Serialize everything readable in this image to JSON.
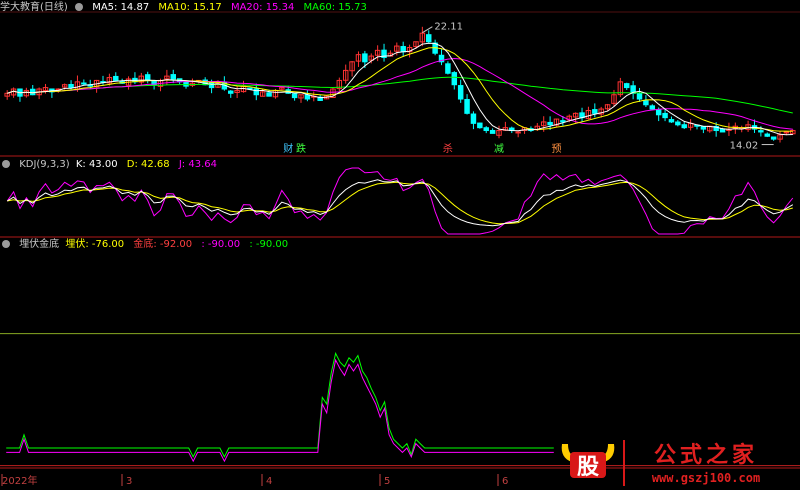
{
  "main_panel": {
    "title": "学大教育(日线)",
    "ma_labels": [
      {
        "label": "MA5: 14.87",
        "color": "#ffffff"
      },
      {
        "label": "MA10: 15.17",
        "color": "#ffff00"
      },
      {
        "label": "MA20: 15.34",
        "color": "#ff00ff"
      },
      {
        "label": "MA60: 15.73",
        "color": "#00ff00"
      }
    ],
    "high_annotation": "22.11",
    "low_annotation": "14.02",
    "signal_labels": [
      {
        "text": "财",
        "color": "#40c8ff"
      },
      {
        "text": "跌",
        "color": "#40ff40"
      },
      {
        "text": "杀",
        "color": "#ff4040"
      },
      {
        "text": "减",
        "color": "#40ff40"
      },
      {
        "text": "预",
        "color": "#ff9040"
      }
    ]
  },
  "kdj_panel": {
    "title": "KDJ(9,3,3)",
    "values": [
      {
        "label": "K: 43.00",
        "color": "#ffffff"
      },
      {
        "label": "D: 42.68",
        "color": "#ffff00"
      },
      {
        "label": "J: 43.64",
        "color": "#ff00ff"
      }
    ]
  },
  "indicator_panel": {
    "title": "埋伏金底",
    "values": [
      {
        "label": "埋伏: -76.00",
        "color": "#ffff00"
      },
      {
        "label": "金底: -92.00",
        "color": "#ff4040"
      },
      {
        "label": ": -90.00",
        "color": "#ff00ff"
      },
      {
        "label": ": -90.00",
        "color": "#00ff00"
      }
    ]
  },
  "x_axis_labels": [
    "2022年",
    "3",
    "4",
    "5",
    "6"
  ],
  "watermark": {
    "logo_char": "股",
    "text": "公式之家",
    "url": "www.gszj100.com"
  },
  "chart_data": [
    {
      "type": "candlestick",
      "title": "学大教育(日线)",
      "y_annotated": {
        "high": 22.11,
        "low": 14.02
      },
      "ma_last": {
        "MA5": 14.87,
        "MA10": 15.17,
        "MA20": 15.34,
        "MA60": 15.73
      },
      "ylim": [
        13.5,
        23.0
      ],
      "colors": {
        "up": "#ff3232",
        "down": "#00ffff",
        "ma5": "#ffffff",
        "ma10": "#ffff00",
        "ma20": "#ff00ff",
        "ma60": "#00ff00"
      },
      "closes": [
        17.6,
        17.9,
        17.4,
        17.8,
        17.5,
        17.9,
        18.0,
        17.7,
        17.9,
        18.2,
        18.0,
        18.4,
        18.3,
        18.1,
        18.5,
        18.4,
        18.7,
        18.5,
        18.3,
        18.6,
        18.4,
        18.8,
        18.5,
        18.2,
        18.5,
        18.8,
        18.6,
        18.4,
        18.1,
        18.3,
        18.5,
        18.2,
        18.0,
        18.3,
        17.9,
        17.6,
        17.8,
        18.1,
        17.9,
        17.5,
        17.7,
        17.4,
        17.8,
        18.0,
        17.6,
        17.3,
        17.5,
        17.2,
        17.4,
        17.1,
        17.4,
        17.9,
        18.5,
        19.2,
        19.8,
        20.3,
        19.8,
        20.2,
        20.6,
        20.1,
        20.4,
        20.9,
        20.5,
        20.8,
        21.2,
        21.8,
        21.2,
        20.4,
        19.8,
        19.0,
        18.2,
        17.2,
        16.2,
        15.5,
        15.2,
        15.0,
        14.8,
        15.0,
        15.2,
        15.0,
        14.9,
        15.2,
        15.0,
        15.3,
        15.6,
        15.4,
        15.8,
        15.6,
        16.0,
        16.2,
        15.9,
        16.4,
        16.2,
        16.5,
        16.8,
        17.5,
        18.4,
        18.0,
        17.6,
        17.2,
        16.8,
        16.5,
        16.1,
        15.9,
        15.6,
        15.4,
        15.2,
        15.5,
        15.3,
        15.1,
        15.3,
        15.0,
        14.9,
        15.1,
        15.3,
        15.2,
        15.4,
        15.1,
        14.9,
        14.6,
        14.4,
        14.7,
        14.9,
        15.0
      ]
    },
    {
      "type": "line",
      "title": "KDJ(9,3,3)",
      "last": {
        "K": 43.0,
        "D": 42.68,
        "J": 43.64
      },
      "ylim": [
        -10,
        110
      ],
      "series": [
        {
          "name": "K",
          "color": "#ffffff"
        },
        {
          "name": "D",
          "color": "#ffff00"
        },
        {
          "name": "J",
          "color": "#ff00ff"
        }
      ]
    },
    {
      "type": "line",
      "title": "埋伏金底",
      "last": {
        "埋伏": -76.0,
        "金底": -92.0,
        "S3": -90.0,
        "S4": -90.0
      },
      "ylim": [
        -100,
        0
      ],
      "reference_lines": [
        {
          "value": -38,
          "color": "#88aa22"
        },
        {
          "value": -98,
          "color": "#c02020"
        }
      ],
      "series": [
        {
          "name": "埋伏",
          "color": "#ffff00"
        },
        {
          "name": "金底",
          "color": "#ff4040"
        },
        {
          "name": "",
          "color": "#ff00ff",
          "values": [
            -92,
            -92,
            -92,
            -92,
            -86,
            -92,
            -92,
            -92,
            -92,
            -92,
            -92,
            -92,
            -92,
            -92,
            -92,
            -92,
            -92,
            -92,
            -92,
            -92,
            -92,
            -92,
            -92,
            -92,
            -92,
            -92,
            -92,
            -92,
            -92,
            -92,
            -92,
            -92,
            -92,
            -92,
            -92,
            -92,
            -92,
            -92,
            -92,
            -92,
            -92,
            -92,
            -96,
            -92,
            -92,
            -92,
            -92,
            -92,
            -92,
            -96,
            -92,
            -92,
            -92,
            -92,
            -92,
            -92,
            -92,
            -92,
            -92,
            -92,
            -92,
            -92,
            -92,
            -92,
            -92,
            -92,
            -92,
            -92,
            -92,
            -92,
            -92,
            -70,
            -74,
            -60,
            -50,
            -54,
            -57,
            -52,
            -55,
            -52,
            -58,
            -62,
            -66,
            -70,
            -76,
            -72,
            -84,
            -88,
            -90,
            -92,
            -90,
            -94,
            -88,
            -90,
            -92,
            -92,
            -92,
            -92,
            -92,
            -92,
            -92,
            -92,
            -92,
            -92,
            -92,
            -92,
            -92,
            -92,
            -92,
            -92,
            -92,
            -92,
            -92,
            -92,
            -92,
            -92,
            -92,
            -92,
            -92,
            -92,
            -92,
            -92,
            -92,
            -92
          ]
        },
        {
          "name": "",
          "color": "#00ff00",
          "values": [
            -90,
            -90,
            -90,
            -90,
            -84,
            -90,
            -90,
            -90,
            -90,
            -90,
            -90,
            -90,
            -90,
            -90,
            -90,
            -90,
            -90,
            -90,
            -90,
            -90,
            -90,
            -90,
            -90,
            -90,
            -90,
            -90,
            -90,
            -90,
            -90,
            -90,
            -90,
            -90,
            -90,
            -90,
            -90,
            -90,
            -90,
            -90,
            -90,
            -90,
            -90,
            -90,
            -94,
            -90,
            -90,
            -90,
            -90,
            -90,
            -90,
            -94,
            -90,
            -90,
            -90,
            -90,
            -90,
            -90,
            -90,
            -90,
            -90,
            -90,
            -90,
            -90,
            -90,
            -90,
            -90,
            -90,
            -90,
            -90,
            -90,
            -90,
            -90,
            -67,
            -70,
            -56,
            -47,
            -51,
            -53,
            -49,
            -51,
            -48,
            -55,
            -58,
            -63,
            -67,
            -73,
            -69,
            -81,
            -86,
            -88,
            -90,
            -88,
            -93,
            -86,
            -88,
            -90,
            -90,
            -90,
            -90,
            -90,
            -90,
            -90,
            -90,
            -90,
            -90,
            -90,
            -90,
            -90,
            -90,
            -90,
            -90,
            -90,
            -90,
            -90,
            -90,
            -90,
            -90,
            -90,
            -90,
            -90,
            -90,
            -90,
            -90,
            -90,
            -90
          ]
        }
      ]
    }
  ]
}
